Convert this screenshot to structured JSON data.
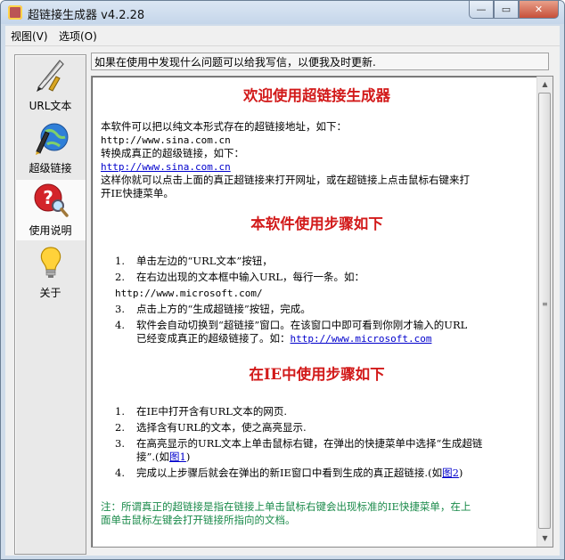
{
  "window": {
    "title": "超链接生成器 v4.2.28",
    "controls": {
      "minimize": "—",
      "maximize": "▭",
      "close": "✕"
    }
  },
  "menu": [
    "视图(V)",
    "选项(O)"
  ],
  "nav": [
    {
      "label": "URL文本",
      "icon": "quill-pen-icon"
    },
    {
      "label": "超级链接",
      "icon": "globe-pen-icon"
    },
    {
      "label": "使用说明",
      "icon": "help-magnifier-icon",
      "selected": true
    },
    {
      "label": "关于",
      "icon": "lightbulb-icon"
    }
  ],
  "infobar": "如果在使用中发现什么问题可以给我写信，以便我及时更新.",
  "content": {
    "heading1": "欢迎使用超链接生成器",
    "intro": {
      "line1": "本软件可以把以纯文本形式存在的超链接地址，如下：",
      "url_plain": "http://www.sina.com.cn",
      "line2": "转换成真正的超级链接，如下：",
      "url_link": "http://www.sina.com.cn",
      "line3": "这样你就可以点击上面的真正超链接来打开网址，或在超链接上点击鼠标右键来打",
      "line4": "开IE快捷菜单。"
    },
    "heading2": "本软件使用步骤如下",
    "steps": {
      "s1": {
        "num": "1.",
        "text": "单击左边的“URL文本”按钮，"
      },
      "s2": {
        "num": "2.",
        "text": "在右边出现的文本框中输入URL，每行一条。如：",
        "sub": "http://www.microsoft.com/"
      },
      "s3": {
        "num": "3.",
        "text": "点击上方的“生成超链接”按钮，完成。"
      },
      "s4": {
        "num": "4.",
        "text_a": "软件会自动切换到“超链接”窗口。在该窗口中即可看到你刚才输入的URL",
        "text_b": "已经变成真正的超级链接了。如：",
        "link": "http://www.microsoft.com"
      }
    },
    "heading3": "在IE中使用步骤如下",
    "ie_steps": {
      "s1": {
        "num": "1.",
        "text": "在IE中打开含有URL文本的网页."
      },
      "s2": {
        "num": "2.",
        "text": "选择含有URL的文本，使之高亮显示."
      },
      "s3": {
        "num": "3.",
        "text_a": "在高亮显示的URL文本上单击鼠标右键，在弹出的快捷菜单中选择“生成超链",
        "text_b": "接”.(如",
        "link": "图1",
        "text_c": ")"
      },
      "s4": {
        "num": "4.",
        "text_a": "完成以上步骤后就会在弹出的新IE窗口中看到生成的真正超链接.(如",
        "link": "图2",
        "text_c": ")"
      }
    },
    "note_line1": "注：所谓真正的超链接是指在链接上单击鼠标右键会出现标准的IE快捷菜单，在上",
    "note_line2": "面单击鼠标左键会打开链接所指向的文档。"
  },
  "scrollbar": {
    "up": "▲",
    "down": "▼",
    "grip": "≡"
  },
  "colors": {
    "heading": "#d21a1a",
    "link": "#0000cc",
    "note": "#1a8a4a"
  }
}
